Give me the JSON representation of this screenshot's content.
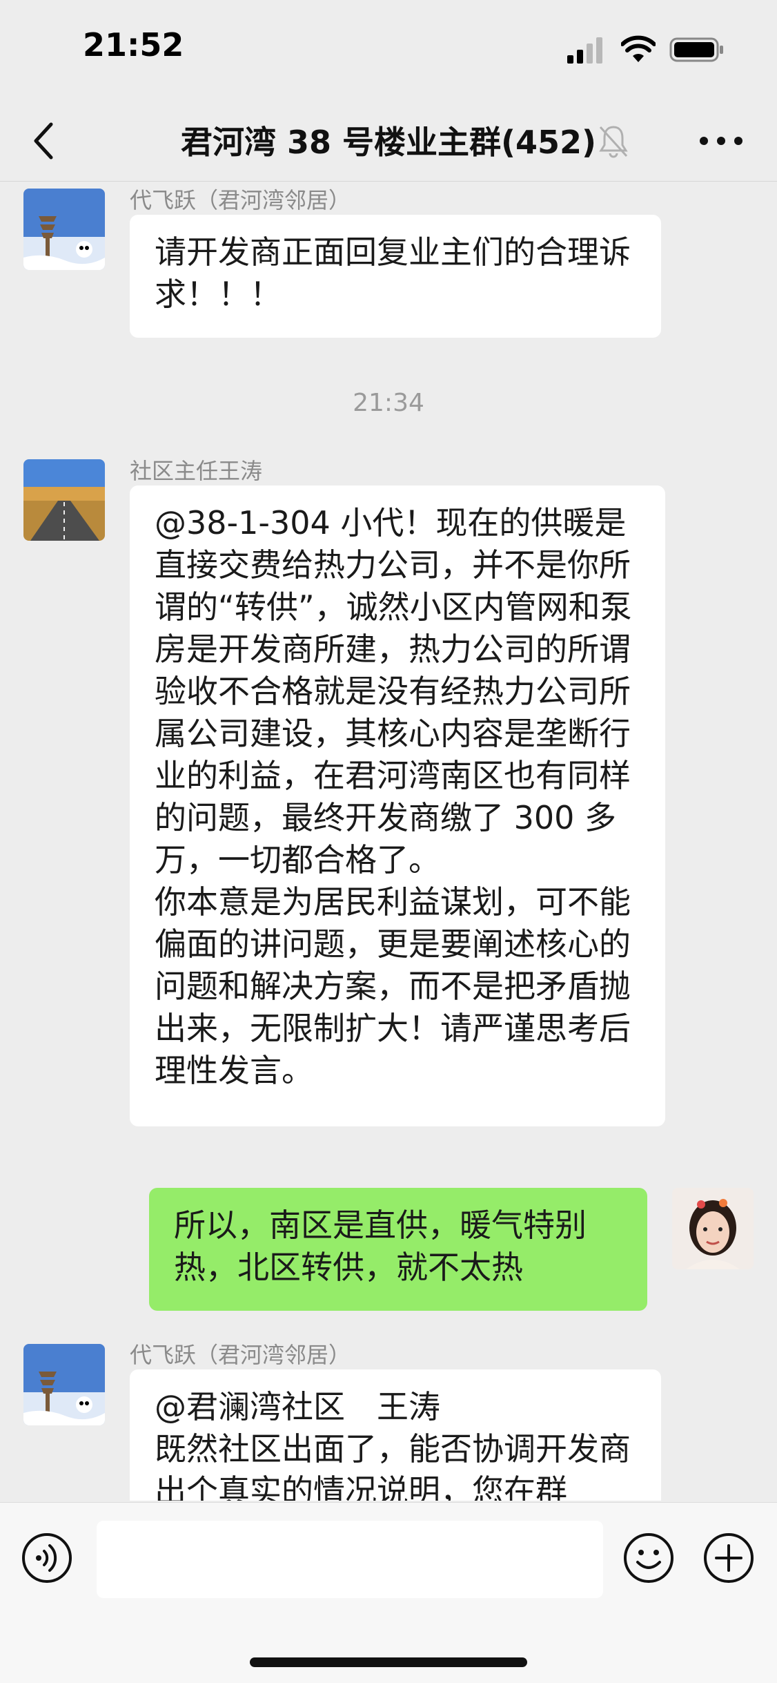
{
  "status_bar": {
    "time": "21:52"
  },
  "nav": {
    "title": "君河湾 38 号楼业主群(452)"
  },
  "messages": [
    {
      "sender": "代飞跃（君河湾邻居）",
      "text": "请开发商正面回复业主们的合理诉求！！！"
    },
    {
      "time": "21:34"
    },
    {
      "sender": "社区主任王涛",
      "text": "@38-1-304 小代！现在的供暖是直接交费给热力公司，并不是你所谓的“转供”，诚然小区内管网和泵房是开发商所建，热力公司的所谓验收不合格就是没有经热力公司所属公司建设，其核心内容是垄断行业的利益，在君河湾南区也有同样的问题，最终开发商缴了 300 多万，一切都合格了。\n你本意是为居民利益谋划，可不能偏面的讲问题，更是要阐述核心的问题和解决方案，而不是把矛盾抛出来，无限制扩大！请严谨思考后理性发言。"
    },
    {
      "sender": "",
      "text": "所以，南区是直供，暖气特别热，北区转供，就不太热",
      "mine": true
    },
    {
      "sender": "代飞跃（君河湾邻居）",
      "text": "@君澜湾社区　王涛\n既然社区出面了，能否协调开发商出个真实的情况说明，您在群"
    }
  ],
  "input": {
    "placeholder": ""
  },
  "colors": {
    "my_bubble": "#95ec69",
    "other_bubble": "#ffffff",
    "background": "#ededed"
  }
}
